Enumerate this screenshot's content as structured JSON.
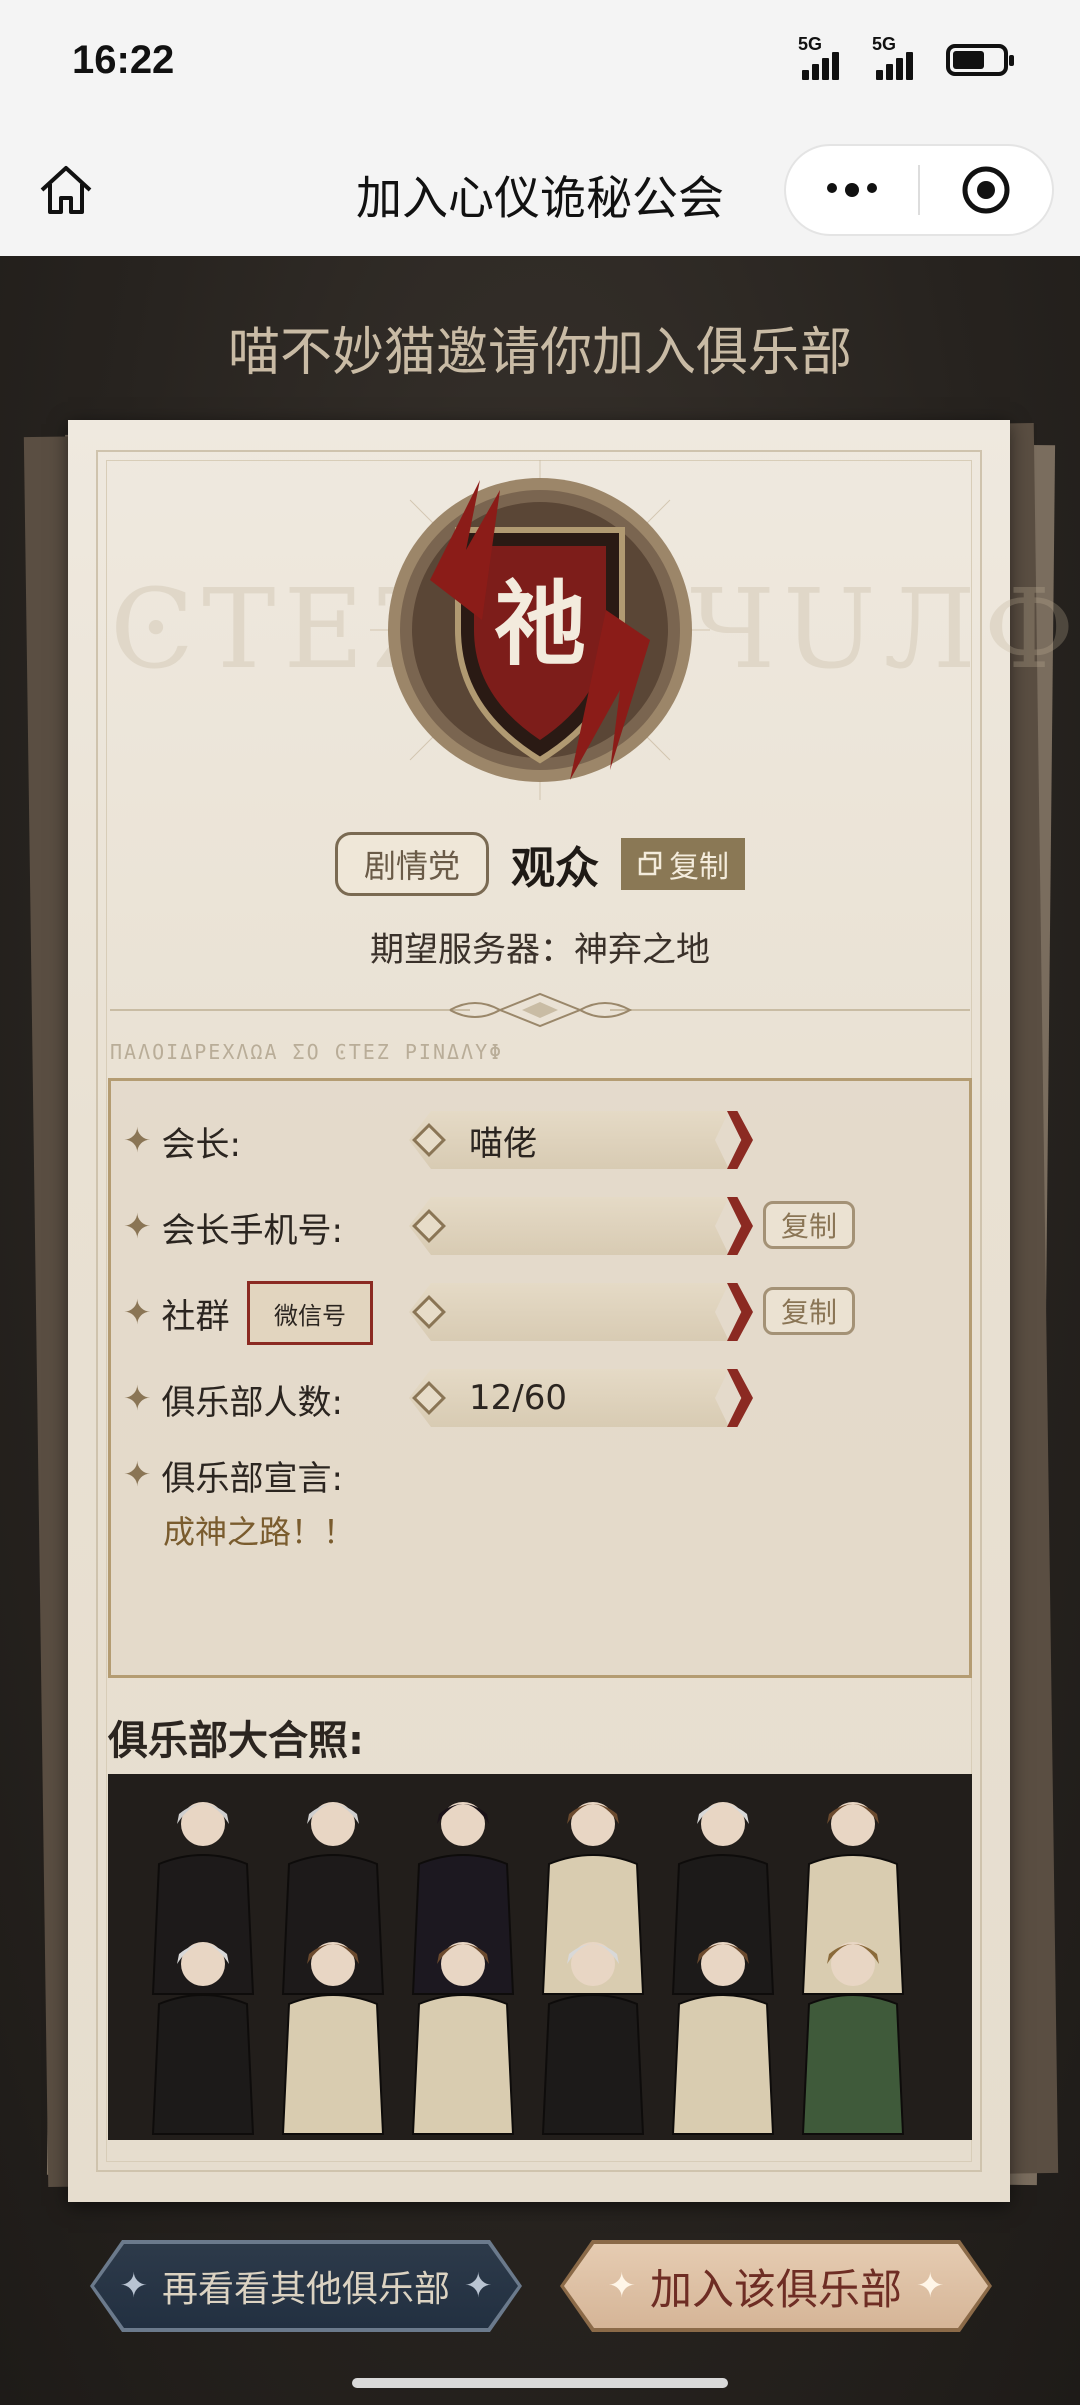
{
  "status_bar": {
    "time": "16:22",
    "signal1_label": "5G",
    "signal2_label": "5G",
    "battery_level": 0.65
  },
  "nav": {
    "title": "加入心仪诡秘公会",
    "home_icon": "home-icon",
    "more_icon": "more-dots-icon",
    "target_icon": "target-icon"
  },
  "invite": {
    "title": "喵不妙猫邀请你加入俱乐部"
  },
  "club": {
    "emblem_char": "祂",
    "tag": "剧情党",
    "name": "观众",
    "copy_label": "复制",
    "server_line": "期望服务器：神弃之地"
  },
  "info": {
    "president_label": "会长:",
    "president_value": "喵佬",
    "phone_label": "会长手机号:",
    "phone_value": "",
    "phone_copy": "复制",
    "community_label": "社群",
    "community_type": "微信号",
    "community_value": "",
    "community_copy": "复制",
    "members_label": "俱乐部人数:",
    "members_value": "12/60",
    "declaration_label": "俱乐部宣言:",
    "declaration_value": "成神之路！！"
  },
  "photo": {
    "title": "俱乐部大合照:"
  },
  "actions": {
    "browse_label": "再看看其他俱乐部",
    "join_label": "加入该俱乐部"
  },
  "colors": {
    "accent_red": "#8b2a22",
    "gold": "#8a7555",
    "paper": "#ede6d9",
    "background": "#2a2622"
  }
}
